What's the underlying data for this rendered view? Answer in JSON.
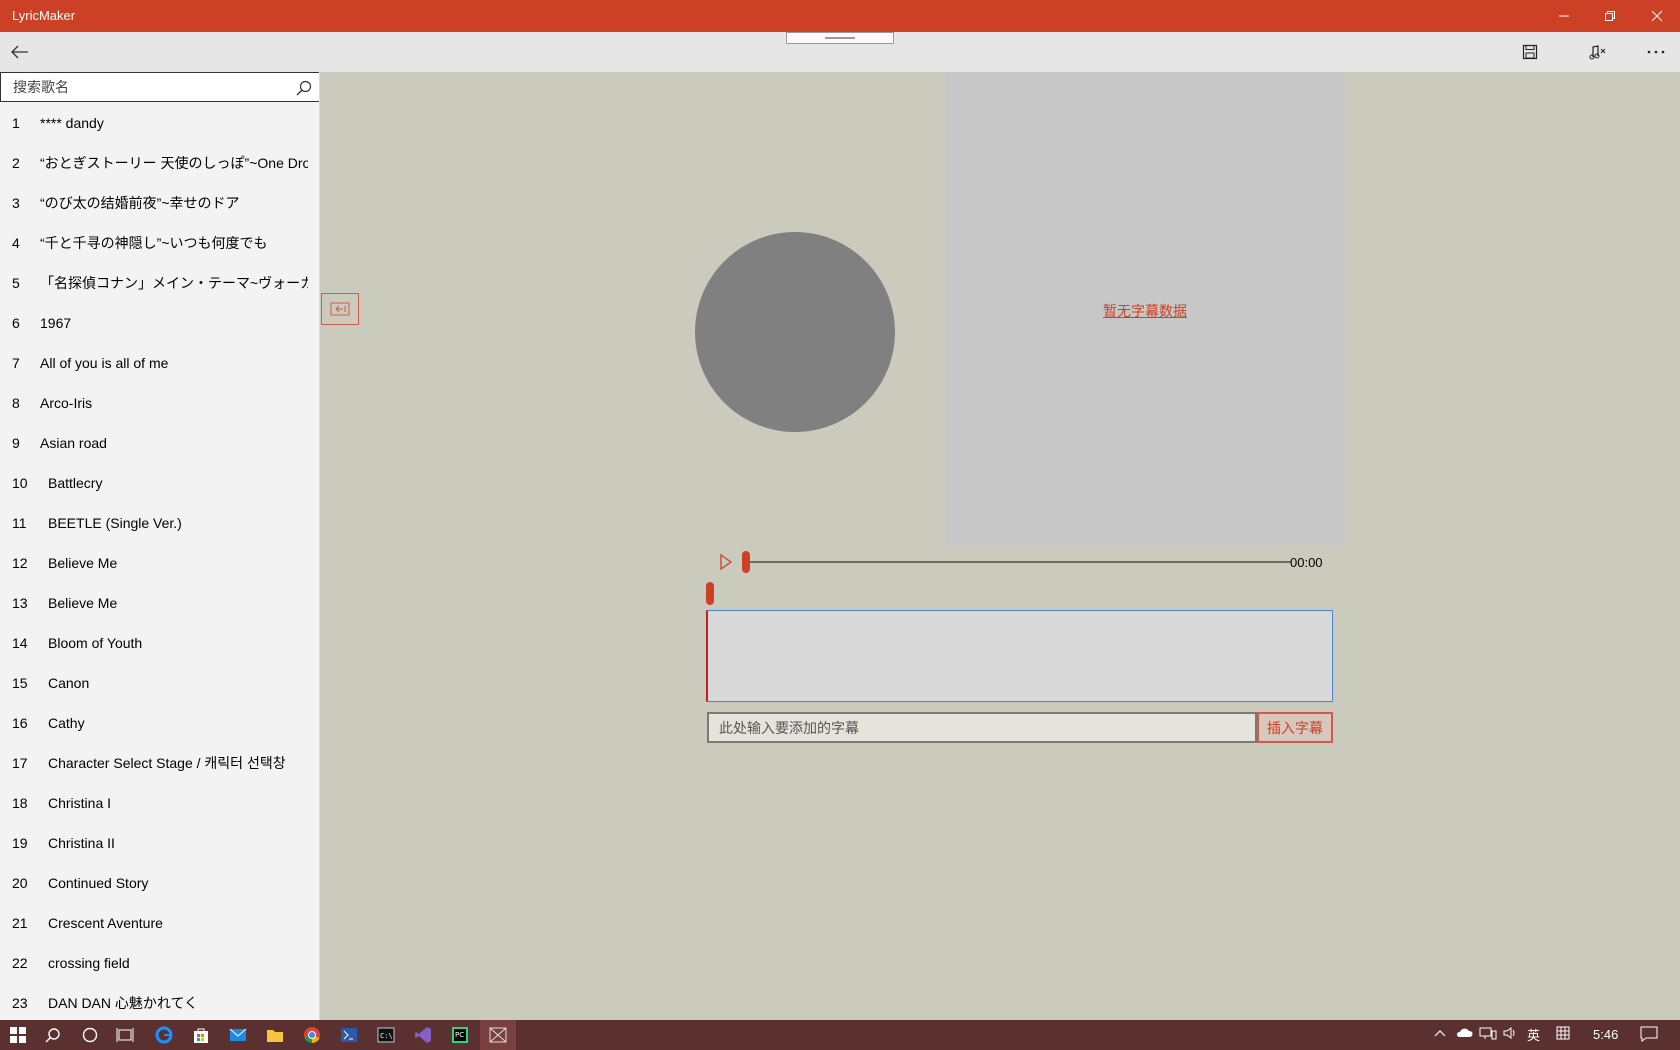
{
  "app": {
    "title": "LyricMaker"
  },
  "search": {
    "placeholder": "搜索歌名"
  },
  "songs": [
    {
      "num": "1",
      "name": "**** dandy"
    },
    {
      "num": "2",
      "name": "“おとぎストーリー 天使のしっぽ”~One Dro"
    },
    {
      "num": "3",
      "name": "“のび太の结婚前夜”~幸せのドア"
    },
    {
      "num": "4",
      "name": "“千と千寻の神隠し”~いつも何度でも"
    },
    {
      "num": "5",
      "name": "「名探偵コナン」メイン・テーマ~ヴォーカ"
    },
    {
      "num": "6",
      "name": "1967"
    },
    {
      "num": "7",
      "name": "All of you is all of me"
    },
    {
      "num": "8",
      "name": "Arco-Iris"
    },
    {
      "num": "9",
      "name": "Asian road"
    },
    {
      "num": "10",
      "name": "Battlecry"
    },
    {
      "num": "11",
      "name": "BEETLE (Single Ver.)"
    },
    {
      "num": "12",
      "name": "Believe Me"
    },
    {
      "num": "13",
      "name": "Believe Me"
    },
    {
      "num": "14",
      "name": "Bloom of Youth"
    },
    {
      "num": "15",
      "name": "Canon"
    },
    {
      "num": "16",
      "name": "Cathy"
    },
    {
      "num": "17",
      "name": "Character Select Stage / 캐릭터 선택창"
    },
    {
      "num": "18",
      "name": "Christina I"
    },
    {
      "num": "19",
      "name": "Christina II"
    },
    {
      "num": "20",
      "name": "Continued Story"
    },
    {
      "num": "21",
      "name": "Crescent Aventure"
    },
    {
      "num": "22",
      "name": "crossing field"
    },
    {
      "num": "23",
      "name": "DAN DAN 心魅かれてく"
    }
  ],
  "lyrics": {
    "empty_text": "暂无字幕数据"
  },
  "player": {
    "time": "00:00",
    "progress": 0
  },
  "caption": {
    "placeholder": "此处输入要添加的字幕",
    "insert_label": "插入字幕"
  },
  "taskbar": {
    "ime": "英",
    "clock": "5:46"
  },
  "colors": {
    "accent": "#cc4125",
    "background": "#cbcbbd",
    "sidebar": "#f3f3f3"
  }
}
